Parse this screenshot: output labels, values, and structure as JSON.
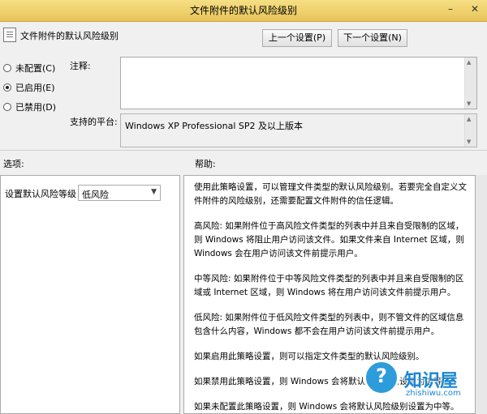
{
  "window": {
    "title": "文件附件的默认风险级别",
    "minimize_glyph": "–",
    "close_glyph": "✕"
  },
  "header": {
    "policy_name": "文件附件的默认风险级别",
    "prev_label": "上一个设置(P)",
    "next_label": "下一个设置(N)"
  },
  "state": {
    "options": [
      {
        "label": "未配置(C)",
        "checked": false
      },
      {
        "label": "已启用(E)",
        "checked": true
      },
      {
        "label": "已禁用(D)",
        "checked": false
      }
    ]
  },
  "comment": {
    "label": "注释:",
    "value": ""
  },
  "platform": {
    "label": "支持的平台:",
    "value": "Windows XP Professional SP2 及以上版本"
  },
  "options_pane": {
    "label": "选项:",
    "setting_label": "设置默认风险等级",
    "select_value": "低风险"
  },
  "help_pane": {
    "label": "帮助:",
    "paragraphs": [
      "使用此策略设置，可以管理文件类型的默认风险级别。若要完全自定义文件附件的风险级别，还需要配置文件附件的信任逻辑。",
      "高风险: 如果附件位于高风险文件类型的列表中并且来自受限制的区域，则 Windows 将阻止用户访问该文件。如果文件来自 Internet 区域，则 Windows 会在用户访问该文件前提示用户。",
      "中等风险: 如果附件位于中等风险文件类型的列表中并且来自受限制的区域或 Internet 区域，则 Windows 将在用户访问该文件前提示用户。",
      "低风险: 如果附件位于低风险文件类型的列表中，则不管文件的区域信息包含什么内容，Windows 都不会在用户访问该文件前提示用户。",
      "如果启用此策略设置，则可以指定文件类型的默认风险级别。",
      "如果禁用此策略设置，则 Windows 会将默认风险级别设置为中等。",
      "如果未配置此策略设置，则 Windows 会将默认风险级别设置为中等。"
    ]
  },
  "watermark": {
    "brand": "知识屋",
    "url": "zhishiwu.com"
  }
}
